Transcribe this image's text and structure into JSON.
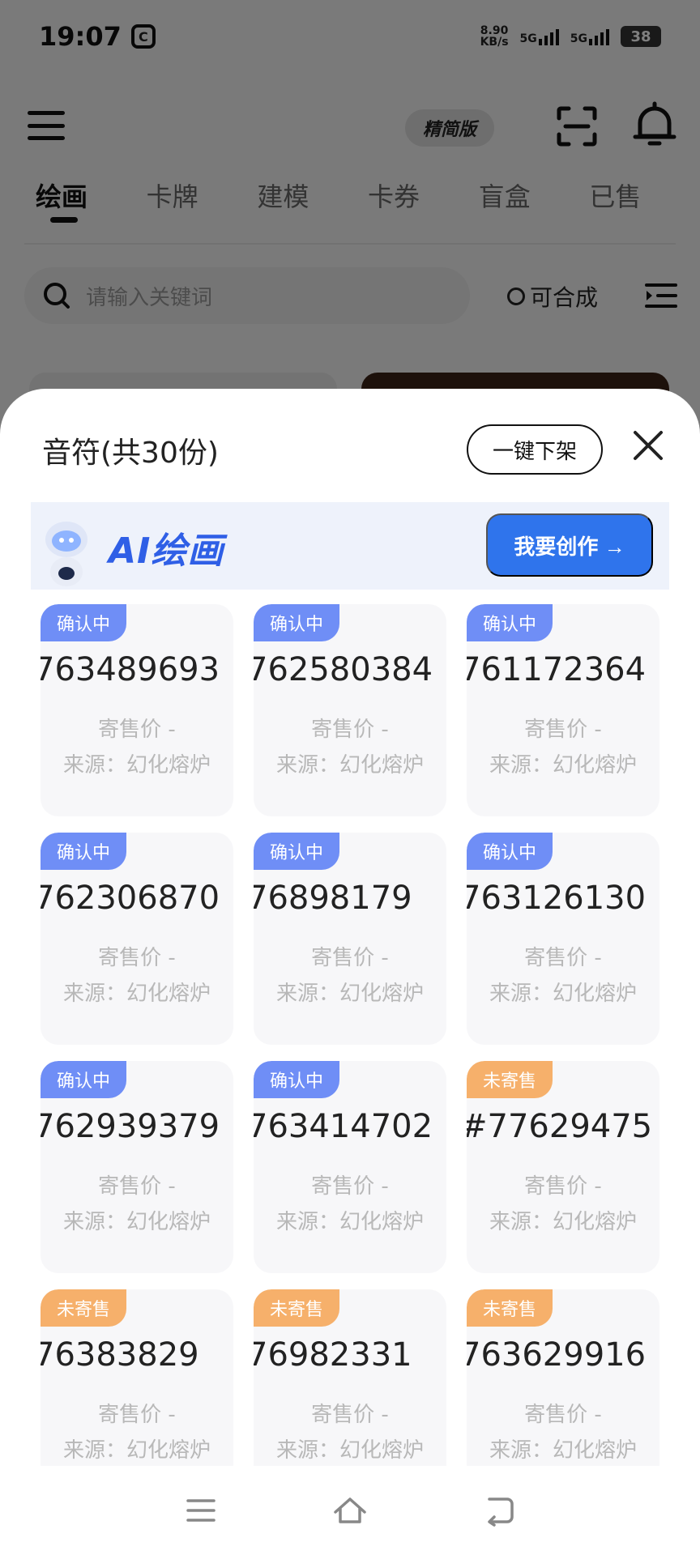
{
  "status": {
    "time": "19:07",
    "speed_value": "8.90",
    "speed_unit": "KB/s",
    "net1": "5G",
    "net2": "5G",
    "battery": "38"
  },
  "header": {
    "lite_badge": "精简版"
  },
  "categories": [
    "绘画",
    "卡牌",
    "建模",
    "卡券",
    "盲盒",
    "已售"
  ],
  "search": {
    "placeholder": "请输入关键词",
    "composable_label": "可合成"
  },
  "sheet": {
    "title": "音符(共30份)",
    "takedown_label": "一键下架",
    "banner": {
      "title": "AI绘画",
      "create_label": "我要创作 →"
    },
    "cards": [
      {
        "status": "确认中",
        "type": "confirming",
        "number": "763489693",
        "price": "寄售价 -",
        "source": "来源：幻化熔炉"
      },
      {
        "status": "确认中",
        "type": "confirming",
        "number": "762580384",
        "price": "寄售价 -",
        "source": "来源：幻化熔炉"
      },
      {
        "status": "确认中",
        "type": "confirming",
        "number": "761172364",
        "price": "寄售价 -",
        "source": "来源：幻化熔炉"
      },
      {
        "status": "确认中",
        "type": "confirming",
        "number": "762306870",
        "price": "寄售价 -",
        "source": "来源：幻化熔炉"
      },
      {
        "status": "确认中",
        "type": "confirming",
        "number": "76898179",
        "price": "寄售价 -",
        "source": "来源：幻化熔炉"
      },
      {
        "status": "确认中",
        "type": "confirming",
        "number": "763126130",
        "price": "寄售价 -",
        "source": "来源：幻化熔炉"
      },
      {
        "status": "确认中",
        "type": "confirming",
        "number": "762939379",
        "price": "寄售价 -",
        "source": "来源：幻化熔炉"
      },
      {
        "status": "确认中",
        "type": "confirming",
        "number": "763414702",
        "price": "寄售价 -",
        "source": "来源：幻化熔炉"
      },
      {
        "status": "未寄售",
        "type": "unsold",
        "number": "#77629475",
        "price": "寄售价 -",
        "source": "来源：幻化熔炉"
      },
      {
        "status": "未寄售",
        "type": "unsold",
        "number": "76383829",
        "price": "寄售价 -",
        "source": "来源：幻化熔炉"
      },
      {
        "status": "未寄售",
        "type": "unsold",
        "number": "76982331",
        "price": "寄售价 -",
        "source": "来源：幻化熔炉"
      },
      {
        "status": "未寄售",
        "type": "unsold",
        "number": "763629916",
        "price": "寄售价 -",
        "source": "来源：幻化熔炉"
      }
    ]
  },
  "colors": {
    "confirming": "#6f8ef6",
    "unsold": "#f6b06b",
    "accent": "#2f74ec"
  }
}
